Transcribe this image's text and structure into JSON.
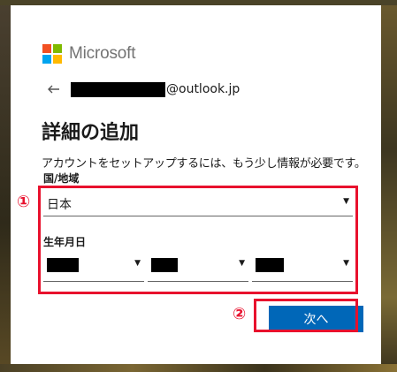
{
  "brand": {
    "name": "Microsoft",
    "logo_colors": [
      "#f25022",
      "#7fba00",
      "#00a4ef",
      "#ffb900"
    ]
  },
  "account": {
    "email_suffix": "@outlook.jp"
  },
  "page": {
    "title": "詳細の追加",
    "subtitle": "アカウントをセットアップするには、もう少し情報が必要です。"
  },
  "form": {
    "country_label": "国/地域",
    "country_value": "日本",
    "birthdate_label": "生年月日"
  },
  "actions": {
    "next_label": "次へ"
  },
  "annotations": {
    "marker_1": "①",
    "marker_2": "②",
    "highlight_color": "#e8112d"
  },
  "colors": {
    "accent": "#0067b8"
  }
}
